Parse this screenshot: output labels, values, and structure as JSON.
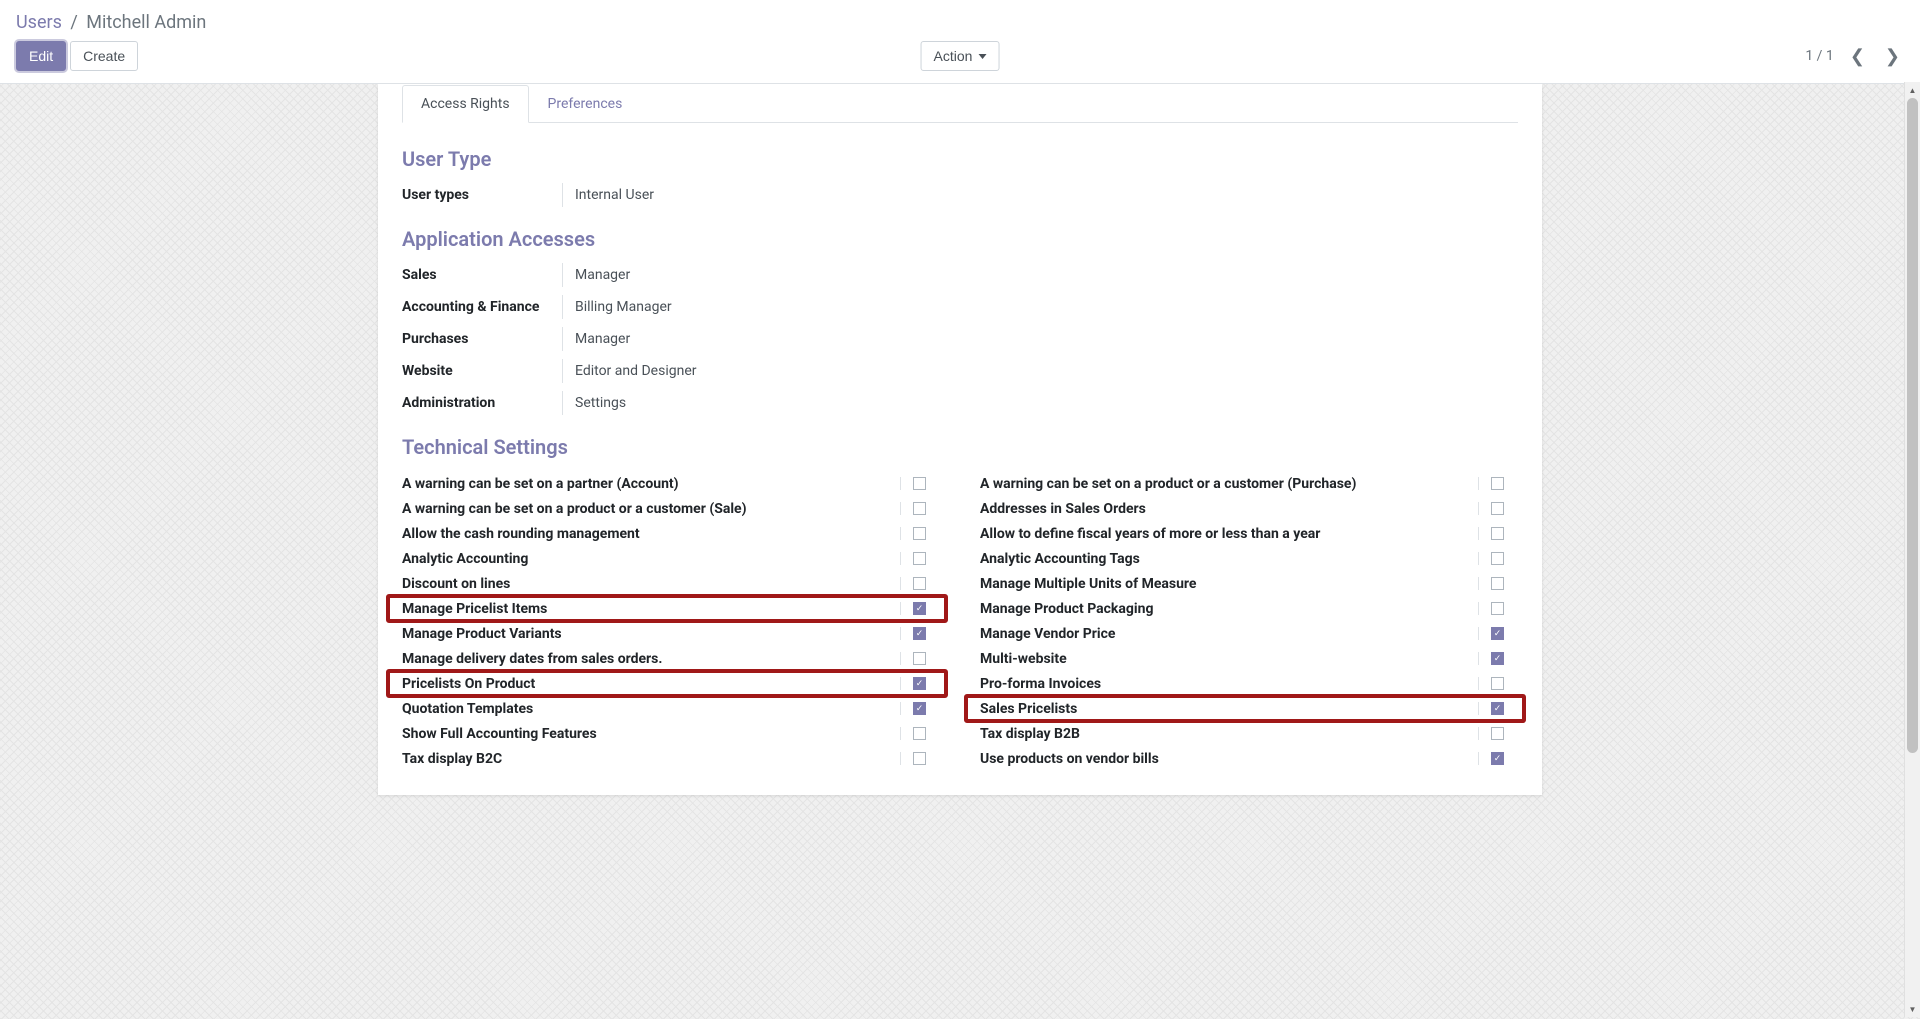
{
  "breadcrumb": {
    "root": "Users",
    "separator": "/",
    "current": "Mitchell Admin"
  },
  "buttons": {
    "edit": "Edit",
    "create": "Create",
    "action": "Action"
  },
  "pager": {
    "text": "1 / 1"
  },
  "tabs": {
    "access_rights": "Access Rights",
    "preferences": "Preferences"
  },
  "sections": {
    "user_type": {
      "title": "User Type",
      "fields": {
        "user_types": {
          "label": "User types",
          "value": "Internal User"
        }
      }
    },
    "application_accesses": {
      "title": "Application Accesses",
      "fields": [
        {
          "label": "Sales",
          "value": "Manager"
        },
        {
          "label": "Accounting & Finance",
          "value": "Billing Manager"
        },
        {
          "label": "Purchases",
          "value": "Manager"
        },
        {
          "label": "Website",
          "value": "Editor and Designer"
        },
        {
          "label": "Administration",
          "value": "Settings"
        }
      ]
    },
    "technical_settings": {
      "title": "Technical Settings",
      "left": [
        {
          "label": "A warning can be set on a partner (Account)",
          "checked": false,
          "highlighted": false
        },
        {
          "label": "A warning can be set on a product or a customer (Sale)",
          "checked": false,
          "highlighted": false
        },
        {
          "label": "Allow the cash rounding management",
          "checked": false,
          "highlighted": false
        },
        {
          "label": "Analytic Accounting",
          "checked": false,
          "highlighted": false
        },
        {
          "label": "Discount on lines",
          "checked": false,
          "highlighted": false
        },
        {
          "label": "Manage Pricelist Items",
          "checked": true,
          "highlighted": true
        },
        {
          "label": "Manage Product Variants",
          "checked": true,
          "highlighted": false
        },
        {
          "label": "Manage delivery dates from sales orders.",
          "checked": false,
          "highlighted": false
        },
        {
          "label": "Pricelists On Product",
          "checked": true,
          "highlighted": true
        },
        {
          "label": "Quotation Templates",
          "checked": true,
          "highlighted": false
        },
        {
          "label": "Show Full Accounting Features",
          "checked": false,
          "highlighted": false
        },
        {
          "label": "Tax display B2C",
          "checked": false,
          "highlighted": false
        }
      ],
      "right": [
        {
          "label": "A warning can be set on a product or a customer (Purchase)",
          "checked": false,
          "highlighted": false
        },
        {
          "label": "Addresses in Sales Orders",
          "checked": false,
          "highlighted": false
        },
        {
          "label": "Allow to define fiscal years of more or less than a year",
          "checked": false,
          "highlighted": false
        },
        {
          "label": "Analytic Accounting Tags",
          "checked": false,
          "highlighted": false
        },
        {
          "label": "Manage Multiple Units of Measure",
          "checked": false,
          "highlighted": false
        },
        {
          "label": "Manage Product Packaging",
          "checked": false,
          "highlighted": false
        },
        {
          "label": "Manage Vendor Price",
          "checked": true,
          "highlighted": false
        },
        {
          "label": "Multi-website",
          "checked": true,
          "highlighted": false
        },
        {
          "label": "Pro-forma Invoices",
          "checked": false,
          "highlighted": false
        },
        {
          "label": "Sales Pricelists",
          "checked": true,
          "highlighted": true
        },
        {
          "label": "Tax display B2B",
          "checked": false,
          "highlighted": false
        },
        {
          "label": "Use products on vendor bills",
          "checked": true,
          "highlighted": false
        }
      ]
    }
  }
}
